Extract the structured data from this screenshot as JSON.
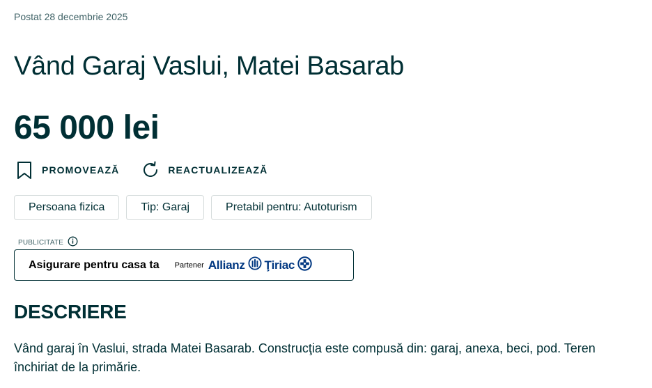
{
  "posted": "Postat 28 decembrie 2025",
  "title": "Vând Garaj Vaslui, Matei Basarab",
  "price": "65 000 lei",
  "actions": {
    "promote": "PROMOVEAZĂ",
    "refresh": "REACTUALIZEAZĂ"
  },
  "tags": [
    "Persoana fizica",
    "Tip: Garaj",
    "Pretabil pentru: Autoturism"
  ],
  "ad": {
    "label": "PUBLICITATE",
    "text": "Asigurare pentru casa ta",
    "partner": "Partener",
    "brand_left": "Allianz",
    "brand_right": "Ţiriac",
    "brand_color": "#003781"
  },
  "description": {
    "heading": "DESCRIERE",
    "text": "Vând garaj în Vaslui, strada Matei Basarab. Construcţia este compusă din: garaj, anexa, beci, pod. Teren închiriat de la primărie."
  },
  "colors": {
    "text": "#002f34",
    "muted": "#406367",
    "border": "#d5dbdb"
  },
  "icons": [
    "bookmark-icon",
    "refresh-icon",
    "info-icon",
    "allianz-logo-icon",
    "tiriac-cross-icon"
  ]
}
